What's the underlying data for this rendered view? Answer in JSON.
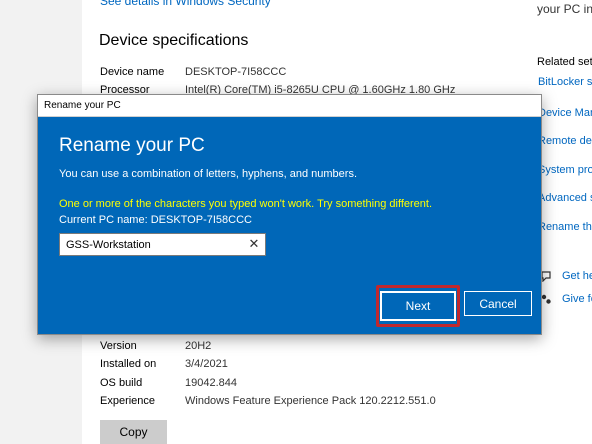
{
  "background": {
    "top_link": "See details in Windows Security",
    "top_right_text": "your PC info",
    "section_title": "Device specifications",
    "specs": [
      {
        "label": "Device name",
        "value": "DESKTOP-7I58CCC"
      },
      {
        "label": "Processor",
        "value": "Intel(R) Core(TM) i5-8265U CPU @ 1.60GHz   1.80 GHz"
      }
    ],
    "windows_specs": [
      {
        "label": "Version",
        "value": "20H2"
      },
      {
        "label": "Installed on",
        "value": "3/4/2021"
      },
      {
        "label": "OS build",
        "value": "19042.844"
      },
      {
        "label": "Experience",
        "value": "Windows Feature Experience Pack 120.2212.551.0"
      }
    ],
    "copy_label": "Copy",
    "related_title": "Related sett",
    "related_links": [
      "BitLocker se",
      "Device Man",
      "Remote des",
      "System prot",
      "Advanced sy",
      "Rename this"
    ],
    "help_links": [
      "Get he",
      "Give fe"
    ]
  },
  "dialog": {
    "titlebar": "Rename your PC",
    "heading": "Rename your PC",
    "description": "You can use a combination of letters, hyphens, and numbers.",
    "error": "One or more of the characters you typed won't work. Try something different.",
    "current_name": "Current PC name: DESKTOP-7I58CCC",
    "input_value": "GSS-Workstation",
    "clear_glyph": "✕",
    "next_label": "Next",
    "cancel_label": "Cancel",
    "highlight_color": "#c0282d",
    "accent_color": "#0067b8",
    "error_color": "#ffff00"
  }
}
